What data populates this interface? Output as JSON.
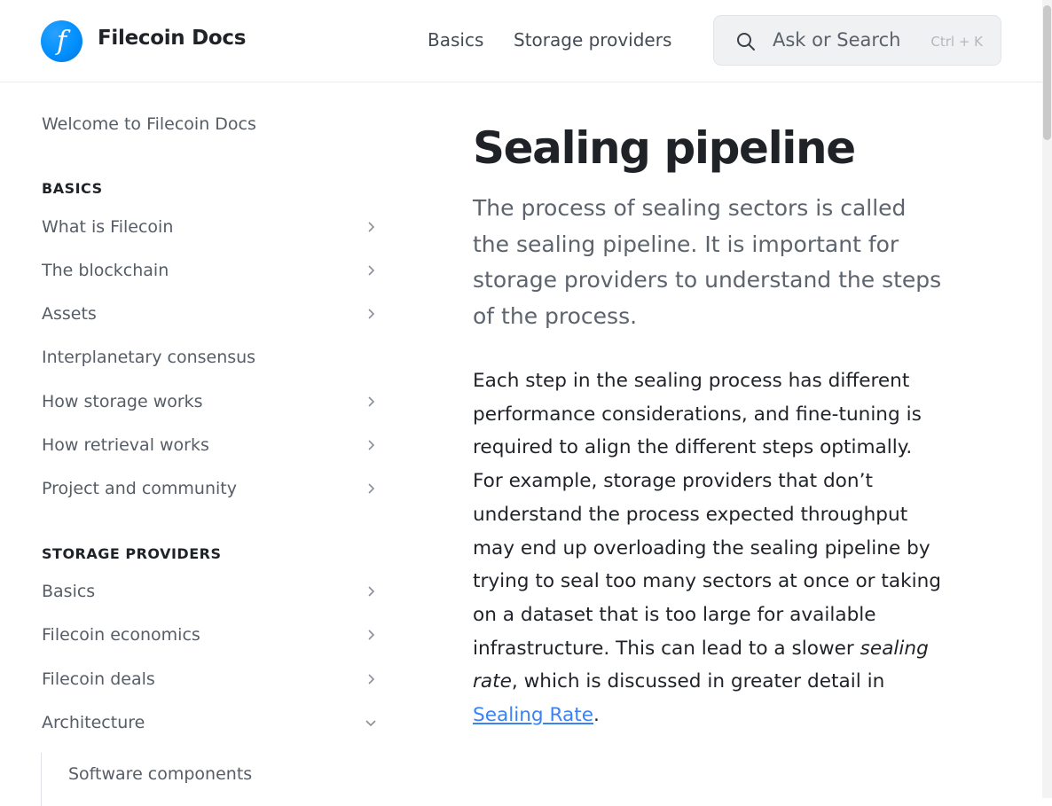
{
  "header": {
    "logo_glyph": "f",
    "site_title": "Filecoin Docs",
    "nav": [
      {
        "label": "Basics"
      },
      {
        "label": "Storage providers"
      }
    ],
    "search": {
      "placeholder": "Ask or Search",
      "shortcut": "Ctrl + K",
      "icon": "search-icon"
    }
  },
  "sidebar": {
    "welcome": "Welcome to Filecoin Docs",
    "sections": [
      {
        "heading": "BASICS",
        "items": [
          {
            "label": "What is Filecoin",
            "state": "collapsed"
          },
          {
            "label": "The blockchain",
            "state": "collapsed"
          },
          {
            "label": "Assets",
            "state": "collapsed"
          },
          {
            "label": "Interplanetary consensus",
            "state": "none"
          },
          {
            "label": "How storage works",
            "state": "collapsed"
          },
          {
            "label": "How retrieval works",
            "state": "collapsed"
          },
          {
            "label": "Project and community",
            "state": "collapsed"
          }
        ]
      },
      {
        "heading": "STORAGE PROVIDERS",
        "items": [
          {
            "label": "Basics",
            "state": "collapsed"
          },
          {
            "label": "Filecoin economics",
            "state": "collapsed"
          },
          {
            "label": "Filecoin deals",
            "state": "collapsed"
          },
          {
            "label": "Architecture",
            "state": "expanded",
            "children": [
              {
                "label": "Software components"
              }
            ]
          }
        ]
      }
    ]
  },
  "main": {
    "title": "Sealing pipeline",
    "lead": "The process of sealing sectors is called the sealing pipeline. It is important for storage providers to understand the steps of the process.",
    "body_before": "Each step in the sealing process has different performance considerations, and fine-tuning is required to align the different steps optimally. For example, storage providers that don’t understand the process expected throughput may end up overloading the sealing pipeline by trying to seal too many sectors at once or taking on a dataset that is too large for available infrastructure. This can lead to a slower ",
    "body_emphasis": "sealing rate",
    "body_middle": ", which is discussed in greater detail in ",
    "body_link": "Sealing Rate",
    "body_after": "."
  },
  "colors": {
    "accent_link": "#3b82f6",
    "logo_blue": "#0090ff"
  }
}
